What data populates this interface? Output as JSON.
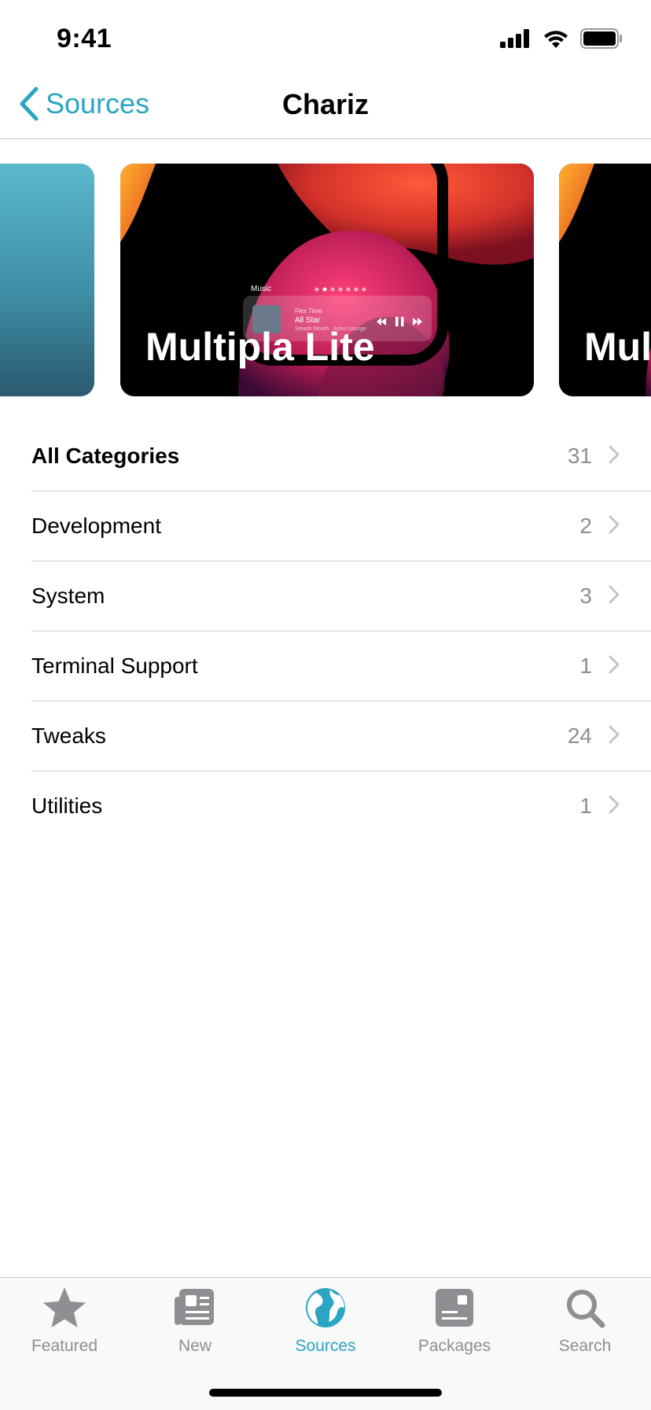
{
  "status_bar": {
    "time": "9:41"
  },
  "nav": {
    "back_label": "Sources",
    "title": "Chariz"
  },
  "featured": {
    "main_title": "Multipla Lite",
    "right_title": "Mult",
    "music_widget": {
      "app": "Music",
      "album": "Flex Time",
      "song": "All Star",
      "artist": "Smash Mouth · Astro Lounge"
    }
  },
  "categories": [
    {
      "name": "All Categories",
      "count": "31"
    },
    {
      "name": "Development",
      "count": "2"
    },
    {
      "name": "System",
      "count": "3"
    },
    {
      "name": "Terminal Support",
      "count": "1"
    },
    {
      "name": "Tweaks",
      "count": "24"
    },
    {
      "name": "Utilities",
      "count": "1"
    }
  ],
  "tabs": [
    {
      "label": "Featured",
      "icon": "star-icon"
    },
    {
      "label": "New",
      "icon": "newspaper-icon"
    },
    {
      "label": "Sources",
      "icon": "globe-icon",
      "active": true
    },
    {
      "label": "Packages",
      "icon": "package-icon"
    },
    {
      "label": "Search",
      "icon": "magnifier-icon"
    }
  ],
  "colors": {
    "accent": "#2aa5c2",
    "secondary": "#8e8e93"
  }
}
